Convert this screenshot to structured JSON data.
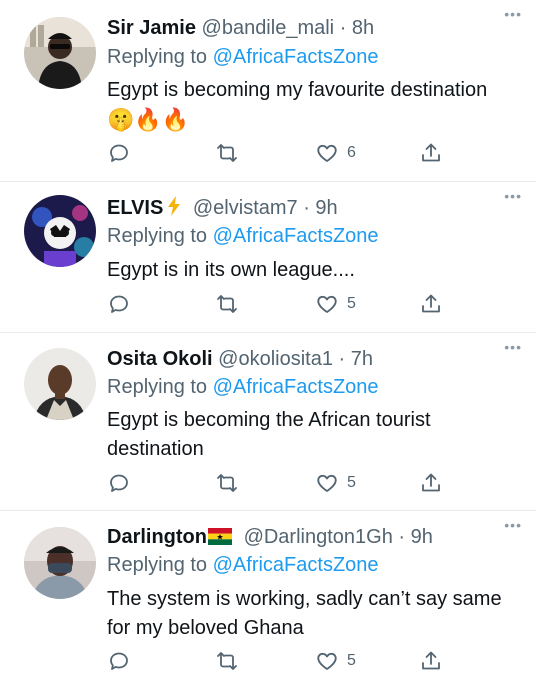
{
  "tweets": [
    {
      "name": "Sir Jamie",
      "handle": "@bandile_mali",
      "time": "· 8h",
      "reply_prefix": "Replying to ",
      "reply_to": "@AfricaFactsZone",
      "text": "Egypt is becoming my favourite destination",
      "emojis": "🤫🔥🔥",
      "likes": "6",
      "avatar_icon": "profile-photo"
    },
    {
      "name": "ELVIS",
      "name_badge": "lightning-icon",
      "handle": "@elvistam7",
      "time": "· 9h",
      "reply_prefix": "Replying to ",
      "reply_to": "@AfricaFactsZone",
      "text": "Egypt is in its own league....",
      "likes": "5",
      "avatar_icon": "profile-photo"
    },
    {
      "name": "Osita Okoli",
      "handle": "@okoliosita1",
      "time": "· 7h",
      "reply_prefix": "Replying to ",
      "reply_to": "@AfricaFactsZone",
      "text": "Egypt is becoming the African tourist destination",
      "likes": "5",
      "avatar_icon": "profile-photo"
    },
    {
      "name": "Darlington",
      "name_badge": "ghana-flag-icon",
      "handle": "@Darlington1Gh",
      "time": "· 9h",
      "reply_prefix": "Replying to ",
      "reply_to": "@AfricaFactsZone",
      "text": "The system is working, sadly can’t say same for my beloved Ghana",
      "likes": "5",
      "avatar_icon": "profile-photo"
    }
  ],
  "more_label": "•••",
  "colors": {
    "link": "#1d9bf0",
    "secondary_text": "#536471",
    "divider": "#e6ecf0"
  }
}
